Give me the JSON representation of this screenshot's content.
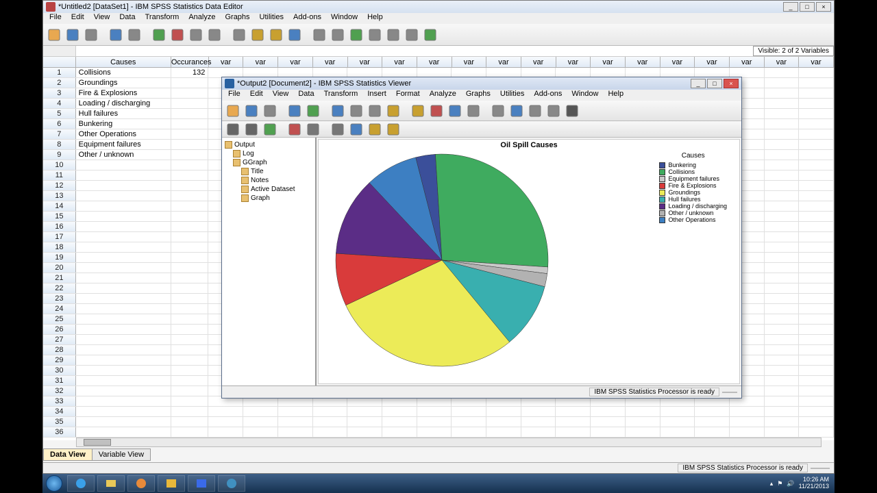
{
  "main_window": {
    "title": "*Untitled2 [DataSet1] - IBM SPSS Statistics Data Editor",
    "menu": [
      "File",
      "Edit",
      "View",
      "Data",
      "Transform",
      "Analyze",
      "Graphs",
      "Utilities",
      "Add-ons",
      "Window",
      "Help"
    ],
    "visible_label": "Visible: 2 of 2 Variables",
    "columns": [
      "Causes",
      "Occurances"
    ],
    "var_label": "var",
    "rows": [
      {
        "n": 1,
        "cause": "Collisions",
        "occ": "132"
      },
      {
        "n": 2,
        "cause": "Groundings",
        "occ": ""
      },
      {
        "n": 3,
        "cause": "Fire & Explosions",
        "occ": ""
      },
      {
        "n": 4,
        "cause": "Loading / discharging",
        "occ": ""
      },
      {
        "n": 5,
        "cause": "Hull failures",
        "occ": ""
      },
      {
        "n": 6,
        "cause": "Bunkering",
        "occ": ""
      },
      {
        "n": 7,
        "cause": "Other Operations",
        "occ": ""
      },
      {
        "n": 8,
        "cause": "Equipment failures",
        "occ": ""
      },
      {
        "n": 9,
        "cause": "Other / unknown",
        "occ": ""
      }
    ],
    "tabs": {
      "data": "Data View",
      "variable": "Variable View"
    },
    "status": "IBM SPSS Statistics Processor is ready"
  },
  "output_window": {
    "title": "*Output2 [Document2] - IBM SPSS Statistics Viewer",
    "menu": [
      "File",
      "Edit",
      "View",
      "Data",
      "Transform",
      "Insert",
      "Format",
      "Analyze",
      "Graphs",
      "Utilities",
      "Add-ons",
      "Window",
      "Help"
    ],
    "tree": {
      "root": "Output",
      "items": [
        "Log",
        "GGraph"
      ],
      "sub": [
        "Title",
        "Notes",
        "Active Dataset",
        "Graph"
      ]
    },
    "chart_title": "Oil Spill Causes",
    "legend_title": "Causes",
    "status": "IBM SPSS Statistics Processor is ready"
  },
  "taskbar": {
    "time": "10:26 AM",
    "date": "11/21/2013"
  },
  "chart_data": {
    "type": "pie",
    "title": "Oil Spill Causes",
    "categories": [
      "Bunkering",
      "Collisions",
      "Equipment failures",
      "Fire & Explosions",
      "Groundings",
      "Hull failures",
      "Loading / discharging",
      "Other / unknown",
      "Other Operations"
    ],
    "values": [
      3,
      27,
      1,
      8,
      29,
      10,
      12,
      2,
      8
    ],
    "colors": [
      "#3b4f9a",
      "#3fab5f",
      "#c8c8c8",
      "#d93b3b",
      "#eceb58",
      "#39afaf",
      "#5b2d86",
      "#b2b2b2",
      "#3d7fc2"
    ]
  }
}
